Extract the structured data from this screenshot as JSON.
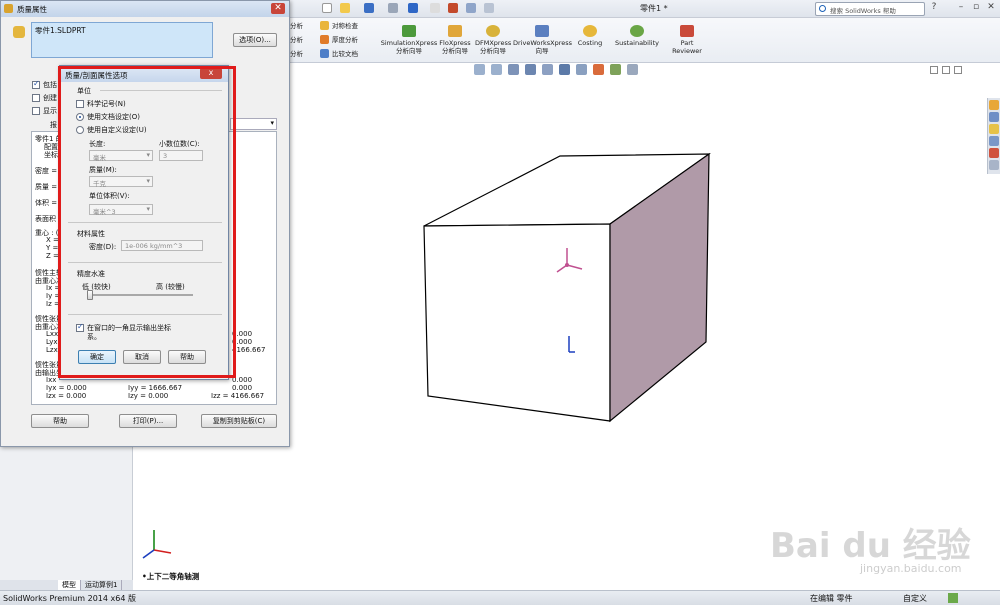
{
  "app": {
    "window_title": "零件1 *",
    "search_placeholder": "搜索 SolidWorks 帮助",
    "status_product": "SolidWorks Premium 2014 x64 版",
    "status_editing": "在编辑 零件",
    "status_custom": "自定义",
    "view_name": "•上下二等角轴测",
    "tabs": [
      "模型",
      "运动算例1"
    ]
  },
  "ribbon": {
    "evaluate_items": [
      "对称检查",
      "厚度分析",
      "比较文档"
    ],
    "partial_items": [
      "分析",
      "分析",
      "分析"
    ],
    "buttons": [
      {
        "label_line1": "SimulationXpress",
        "label_line2": "分析向导"
      },
      {
        "label_line1": "FloXpress",
        "label_line2": "分析向导"
      },
      {
        "label_line1": "DFMXpress",
        "label_line2": "分析向导"
      },
      {
        "label_line1": "DriveWorksXpress",
        "label_line2": "向导"
      },
      {
        "label_line1": "Costing",
        "label_line2": ""
      },
      {
        "label_line1": "Sustainability",
        "label_line2": ""
      },
      {
        "label_line1": "Part",
        "label_line2": "Reviewer"
      }
    ]
  },
  "mass_window": {
    "title": "质量属性",
    "part_file": "零件1.SLDPRT",
    "options_button": "选项(O)...",
    "checkbox_labels": [
      "包括",
      "创建",
      "显示"
    ],
    "report_label": "报",
    "results_lines": [
      "零件1 的",
      "配置",
      "坐标",
      "密度 =",
      "质量 =",
      "体积 =",
      "表面积",
      "重心 : (",
      "X =",
      "Y =",
      "Z =",
      "惯性主轴",
      "由重心决",
      "Ix =",
      "Iy =",
      "Iz =",
      "惯性张量",
      "由重心决",
      "Lxx",
      "Lyx",
      "Lzx",
      "惯性张量",
      "由输出坐",
      "Ixx",
      "Iyx = 0.000",
      "Izx = 0.000"
    ],
    "right_values": [
      "0.000",
      "0.000",
      "4166.667",
      "0.000",
      "0.000"
    ],
    "bottom_values": [
      "Iyy = 1666.667",
      "Izy = 0.000",
      "Izz = 4166.667"
    ],
    "buttons": {
      "help": "帮助",
      "print": "打印(P)...",
      "copy": "复制到剪贴板(C)"
    }
  },
  "options_dialog": {
    "title": "质量/剖面属性选项",
    "close_symbol": "x",
    "units_group": "单位",
    "sci_notation": "科学记号(N)",
    "use_doc_settings": "使用文档设定(O)",
    "use_custom_settings": "使用自定义设定(U)",
    "length_label": "长度:",
    "length_value": "毫米",
    "decimals_label": "小数位数(C):",
    "decimals_value": "3",
    "mass_label": "质量(M):",
    "mass_value": "千克",
    "unit_volume_label": "单位体积(V):",
    "unit_volume_value": "毫米^3",
    "material_group": "材料属性",
    "density_label": "密度(D):",
    "density_value": "1e-006 kg/mm^3",
    "accuracy_group": "精度水准",
    "low_label": "低 (较快)",
    "high_label": "高 (较慢)",
    "accuracy_level": 0.0,
    "corner_axis_text_1": "在窗口的一角显示输出坐标",
    "corner_axis_text_2": "系。",
    "ok": "确定",
    "cancel": "取消",
    "help": "帮助",
    "sci_notation_checked": false,
    "use_doc_settings_selected": true,
    "corner_axis_checked": true
  },
  "watermark": {
    "logo": "Bai du 经验",
    "url": "jingyan.baidu.com"
  },
  "colors": {
    "cube_side": "#b09aa8",
    "highlight": "#e01b1b",
    "accent": "#1d62b8"
  }
}
